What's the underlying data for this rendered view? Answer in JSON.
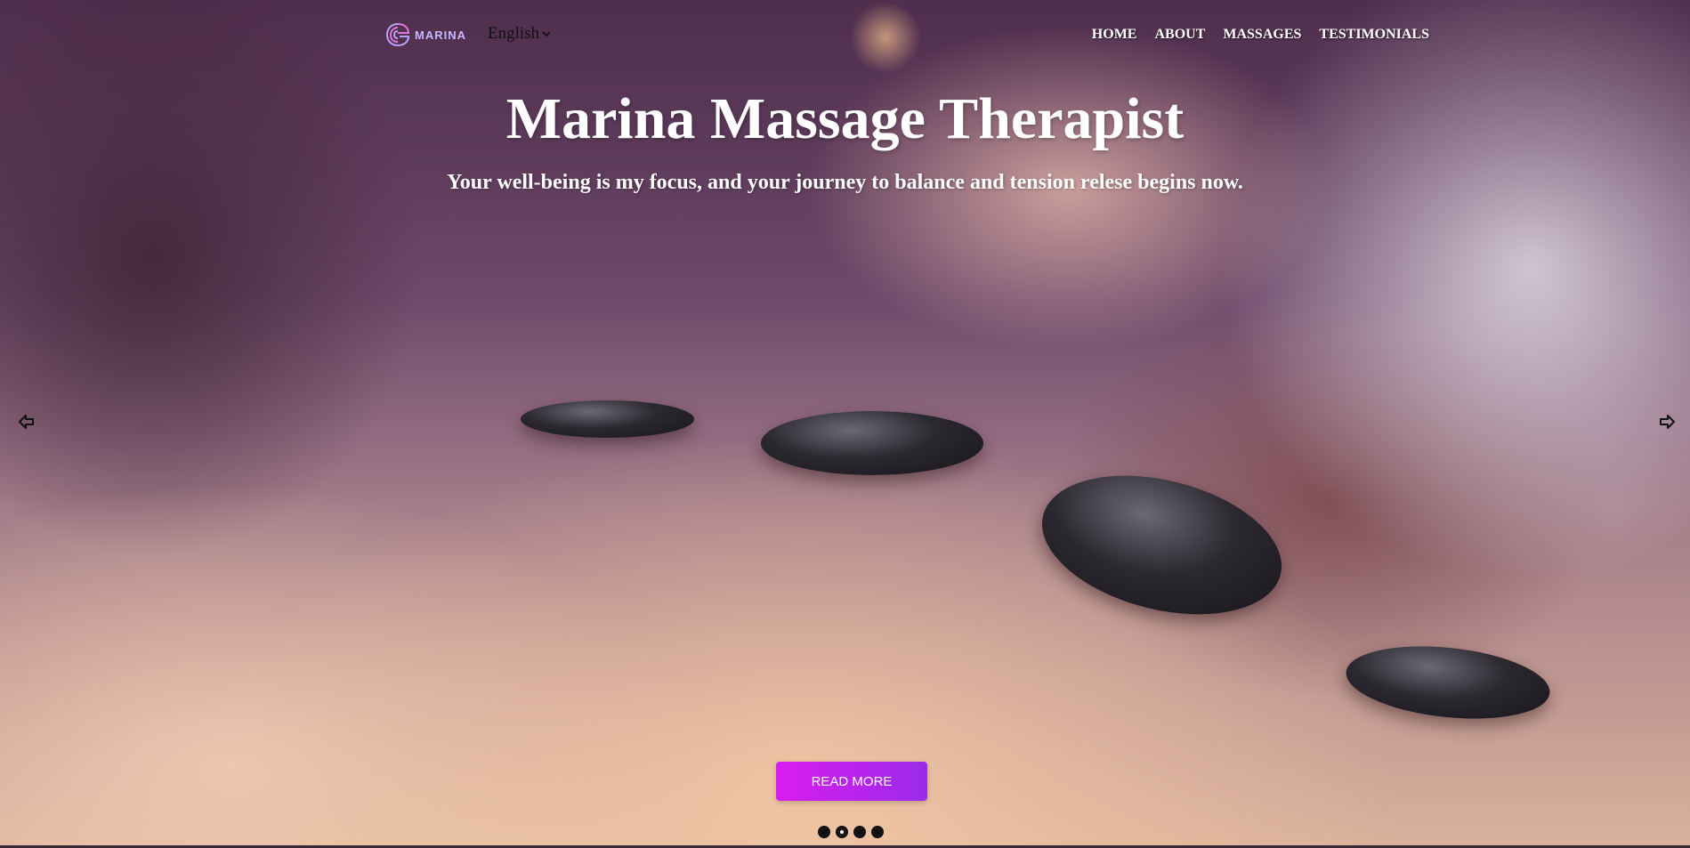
{
  "nav": {
    "logo_text": "MARINA",
    "language": "English",
    "menu": [
      {
        "label": "HOME"
      },
      {
        "label": "ABOUT"
      },
      {
        "label": "MASSAGES"
      },
      {
        "label": "TESTIMONIALS"
      }
    ]
  },
  "hero": {
    "title": "Marina Massage Therapist",
    "subtitle": "Your well-being is my focus, and your journey to balance and tension relese begins now.",
    "button_label": "READ MORE",
    "slide_count": 4,
    "active_slide": 2
  },
  "icons": {
    "logo": "marina-logo-icon",
    "language_dropdown": "chevron-down-icon",
    "prev": "arrow-left-icon",
    "next": "arrow-right-icon"
  },
  "colors": {
    "accent_start": "#d91cf0",
    "accent_end": "#9b2be8",
    "logo": "#c9b7ff"
  }
}
